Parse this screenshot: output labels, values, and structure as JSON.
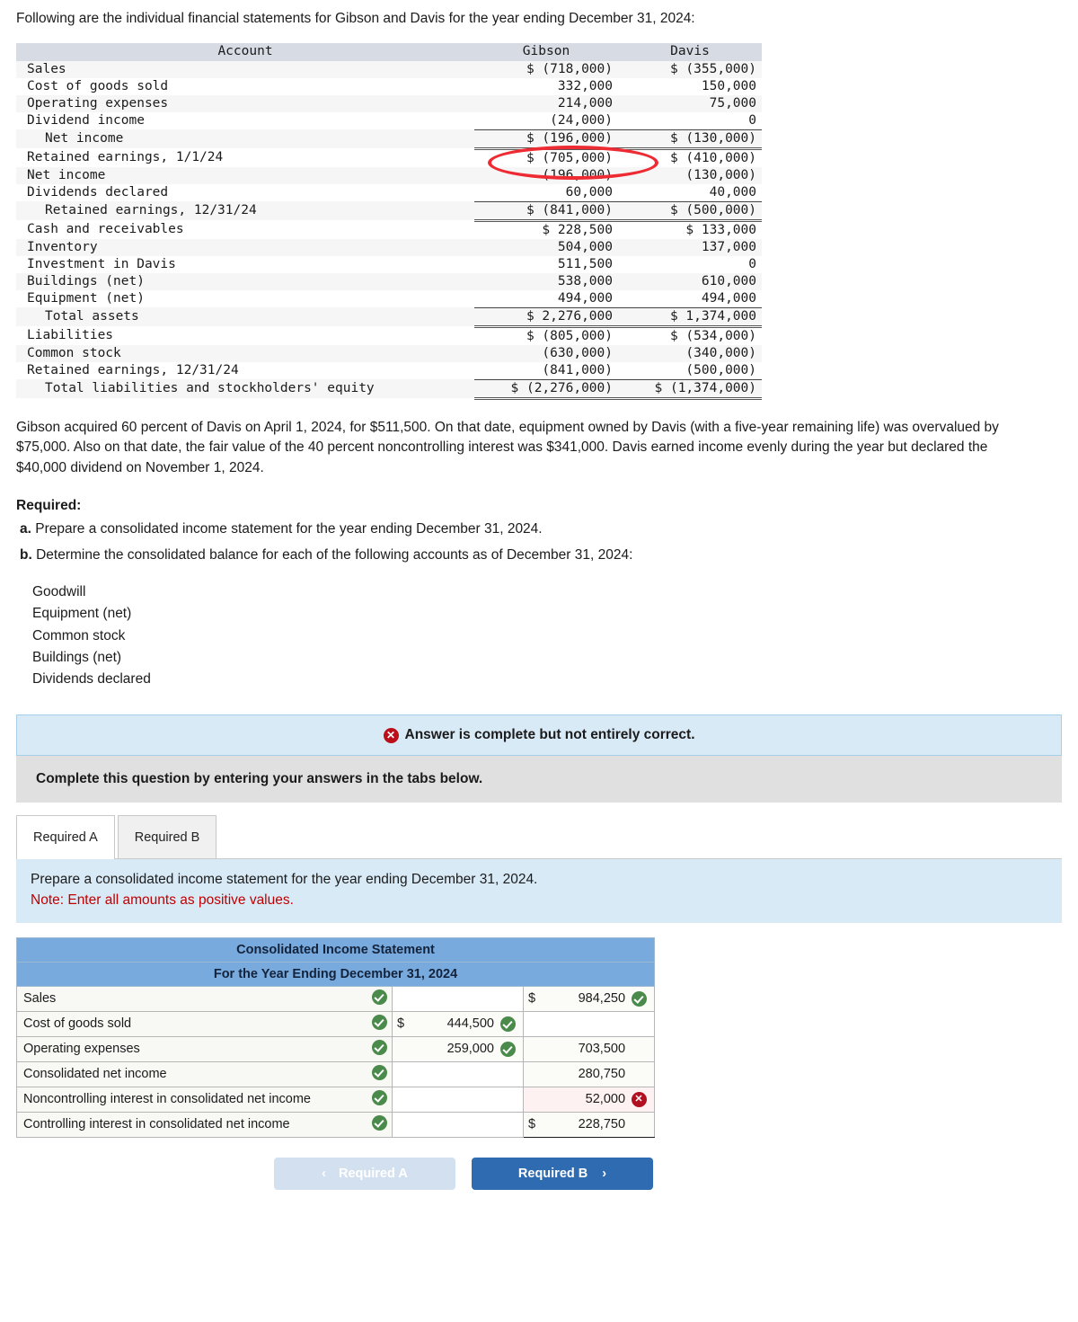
{
  "intro": "Following are the individual financial statements for Gibson and Davis for the year ending December 31, 2024:",
  "fin_table": {
    "headers": [
      "Account",
      "Gibson",
      "Davis"
    ],
    "rows": [
      {
        "account": "Sales",
        "gibson": "$ (718,000)",
        "davis": "$ (355,000)",
        "indent": false
      },
      {
        "account": "Cost of goods sold",
        "gibson": "332,000",
        "davis": "150,000",
        "indent": false
      },
      {
        "account": "Operating expenses",
        "gibson": "214,000",
        "davis": "75,000",
        "indent": false
      },
      {
        "account": "Dividend income",
        "gibson": "(24,000)",
        "davis": "0",
        "indent": false
      },
      {
        "account": "Net income",
        "gibson": "$ (196,000)",
        "davis": "$ (130,000)",
        "indent": true,
        "rule": "top"
      },
      {
        "account": "Retained earnings, 1/1/24",
        "gibson": "$ (705,000)",
        "davis": "$ (410,000)",
        "indent": false,
        "rule": "double-top"
      },
      {
        "account": "Net income",
        "gibson": "(196,000)",
        "davis": "(130,000)",
        "indent": false
      },
      {
        "account": "Dividends declared",
        "gibson": "60,000",
        "davis": "40,000",
        "indent": false
      },
      {
        "account": "Retained earnings, 12/31/24",
        "gibson": "$ (841,000)",
        "davis": "$ (500,000)",
        "indent": true,
        "rule": "top"
      },
      {
        "account": "Cash and receivables",
        "gibson": "$ 228,500",
        "davis": "$ 133,000",
        "indent": false,
        "rule": "double-top"
      },
      {
        "account": "Inventory",
        "gibson": "504,000",
        "davis": "137,000",
        "indent": false
      },
      {
        "account": "Investment in Davis",
        "gibson": "511,500",
        "davis": "0",
        "indent": false
      },
      {
        "account": "Buildings (net)",
        "gibson": "538,000",
        "davis": "610,000",
        "indent": false
      },
      {
        "account": "Equipment (net)",
        "gibson": "494,000",
        "davis": "494,000",
        "indent": false
      },
      {
        "account": "Total assets",
        "gibson": "$ 2,276,000",
        "davis": "$ 1,374,000",
        "indent": true,
        "rule": "top"
      },
      {
        "account": "Liabilities",
        "gibson": "$ (805,000)",
        "davis": "$ (534,000)",
        "indent": false,
        "rule": "double-top"
      },
      {
        "account": "Common stock",
        "gibson": "(630,000)",
        "davis": "(340,000)",
        "indent": false
      },
      {
        "account": "Retained earnings, 12/31/24",
        "gibson": "(841,000)",
        "davis": "(500,000)",
        "indent": false
      },
      {
        "account": "Total liabilities and stockholders' equity",
        "gibson": "$ (2,276,000)",
        "davis": "$ (1,374,000)",
        "indent": true,
        "rule": "top",
        "rule_bottom": "double"
      }
    ]
  },
  "paragraph": "Gibson acquired 60 percent of Davis on April 1, 2024, for $511,500. On that date, equipment owned by Davis (with a five-year remaining life) was overvalued by $75,000. Also on that date, the fair value of the 40 percent noncontrolling interest was $341,000. Davis earned income evenly during the year but declared the $40,000 dividend on November 1, 2024.",
  "required_heading": "Required:",
  "required_items": [
    {
      "marker": "a.",
      "text": "Prepare a consolidated income statement for the year ending December 31, 2024."
    },
    {
      "marker": "b.",
      "text": "Determine the consolidated balance for each of the following accounts as of December 31, 2024:"
    }
  ],
  "account_list": [
    "Goodwill",
    "Equipment (net)",
    "Common stock",
    "Buildings (net)",
    "Dividends declared"
  ],
  "alert": {
    "icon": "x-badge",
    "icon_glyph": "✕",
    "text": "Answer is complete but not entirely correct."
  },
  "subbar_text": "Complete this question by entering your answers in the tabs below.",
  "tabs": [
    {
      "label": "Required A",
      "active": true
    },
    {
      "label": "Required B",
      "active": false
    }
  ],
  "note": {
    "line1": "Prepare a consolidated income statement for the year ending December 31, 2024.",
    "line2": "Note: Enter all amounts as positive values."
  },
  "answer_table": {
    "title": "Consolidated Income Statement",
    "subtitle": "For the Year Ending December 31, 2024",
    "rows": [
      {
        "label": "Sales",
        "label_mark": "ok",
        "col1": {
          "currency": "",
          "value": "",
          "mark": "",
          "blank": true
        },
        "col2": {
          "currency": "$",
          "value": "984,250",
          "mark": "ok",
          "blank": false
        }
      },
      {
        "label": "Cost of goods sold",
        "label_mark": "ok",
        "col1": {
          "currency": "$",
          "value": "444,500",
          "mark": "ok",
          "blank": false
        },
        "col2": {
          "currency": "",
          "value": "",
          "mark": "",
          "blank": true
        }
      },
      {
        "label": "Operating expenses",
        "label_mark": "ok",
        "col1": {
          "currency": "",
          "value": "259,000",
          "mark": "ok",
          "blank": false
        },
        "col2": {
          "currency": "",
          "value": "703,500",
          "mark": "",
          "blank": false
        }
      },
      {
        "label": "Consolidated net income",
        "label_mark": "ok",
        "col1": {
          "currency": "",
          "value": "",
          "mark": "",
          "blank": true
        },
        "col2": {
          "currency": "",
          "value": "280,750",
          "mark": "",
          "blank": false,
          "topline": true
        }
      },
      {
        "label": "Noncontrolling interest in consolidated net income",
        "label_mark": "ok",
        "col1": {
          "currency": "",
          "value": "",
          "mark": "",
          "blank": true
        },
        "col2": {
          "currency": "",
          "value": "52,000",
          "mark": "bad",
          "blank": false,
          "highlight": true
        }
      },
      {
        "label": "Controlling interest in consolidated net income",
        "label_mark": "ok",
        "col1": {
          "currency": "",
          "value": "",
          "mark": "",
          "blank": true
        },
        "col2": {
          "currency": "$",
          "value": "228,750",
          "mark": "",
          "blank": false,
          "topline": true,
          "botline": true
        }
      }
    ]
  },
  "nav": {
    "prev_label": "Required A",
    "prev_chevron": "‹",
    "next_label": "Required B",
    "next_chevron": "›"
  },
  "colors": {
    "header_blue": "#78aadd",
    "note_blue": "#d9eaf7",
    "subbar_gray": "#e0e0e0",
    "ok_green": "#4a8a4a",
    "bad_red": "#b01020",
    "anno_red": "#ee2b33",
    "btn_blue": "#2f6bb0"
  }
}
